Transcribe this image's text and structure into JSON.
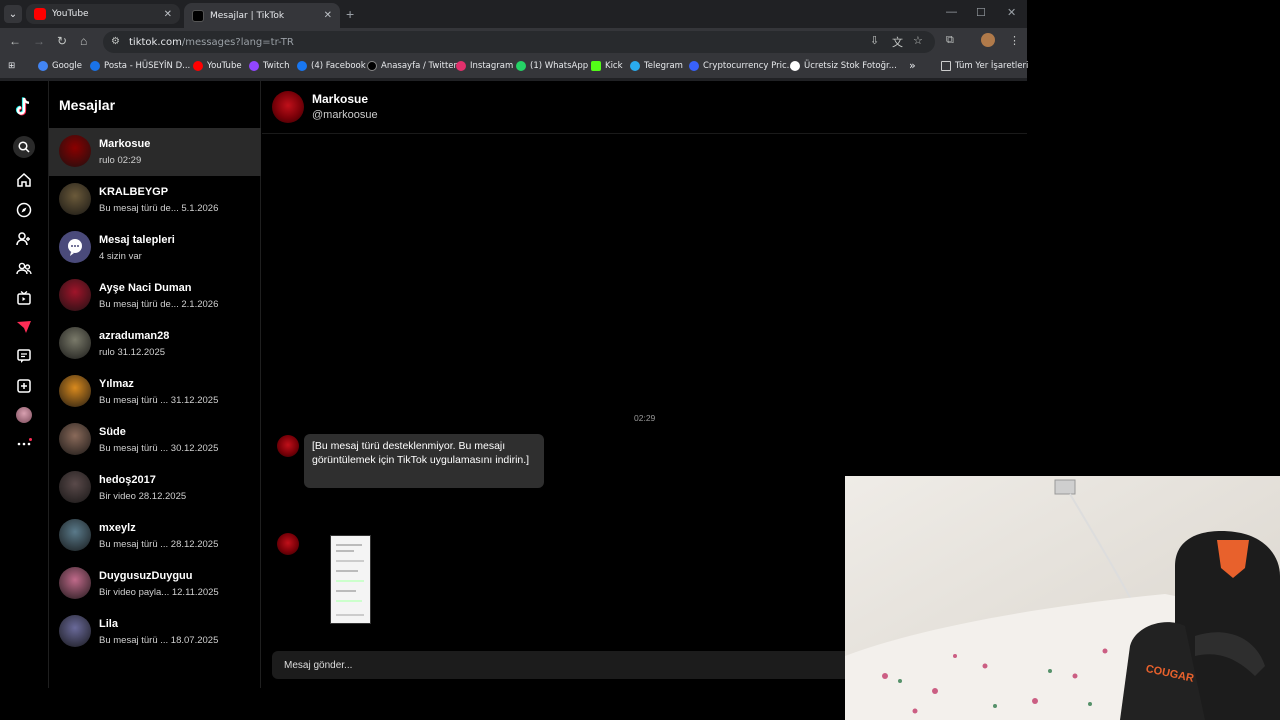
{
  "browser": {
    "tabs": [
      {
        "title": "YouTube",
        "favicon_color": "#ff0000"
      },
      {
        "title": "Mesajlar | TikTok",
        "favicon_color": "#000000"
      }
    ],
    "url_host": "tiktok.com",
    "url_path": "/messages?lang=tr-TR",
    "bookmarks": [
      {
        "label": "Google",
        "icon": "google-icon",
        "color": "#4285f4"
      },
      {
        "label": "Posta - HÜSEYİN D...",
        "icon": "mail-icon",
        "color": "#1a73e8"
      },
      {
        "label": "YouTube",
        "icon": "youtube-icon",
        "color": "#ff0000"
      },
      {
        "label": "Twitch",
        "icon": "twitch-icon",
        "color": "#9146ff"
      },
      {
        "label": "(4) Facebook",
        "icon": "facebook-icon",
        "color": "#1877f2"
      },
      {
        "label": "Anasayfa / Twitter",
        "icon": "x-icon",
        "color": "#000000"
      },
      {
        "label": "Instagram",
        "icon": "instagram-icon",
        "color": "#e1306c"
      },
      {
        "label": "(1) WhatsApp",
        "icon": "whatsapp-icon",
        "color": "#25d366"
      },
      {
        "label": "Kick",
        "icon": "kick-icon",
        "color": "#53fc18"
      },
      {
        "label": "Telegram",
        "icon": "telegram-icon",
        "color": "#2aabee"
      },
      {
        "label": "Cryptocurrency Pric...",
        "icon": "coin-icon",
        "color": "#3861fb"
      },
      {
        "label": "Ücretsiz Stok Fotoğr...",
        "icon": "photo-icon",
        "color": "#ffffff"
      }
    ],
    "bookmarks_overflow": "»",
    "all_bookmarks": "Tüm Yer İşaretleri"
  },
  "sidebar_title": "Mesajlar",
  "conversations": [
    {
      "name": "Markosue",
      "sub": "rulo 02:29",
      "selected": true,
      "avatar_color": "#8b0000"
    },
    {
      "name": "KRALBEYGP",
      "sub": "Bu mesaj türü de...  5.1.2026",
      "avatar_color": "#6b5a3a"
    },
    {
      "name": "Mesaj talepleri",
      "sub": "4 sizin var",
      "avatar_color": "#4a4a7a"
    },
    {
      "name": "Ayşe Naci Duman",
      "sub": "Bu mesaj türü de...  2.1.2026",
      "avatar_color": "#a0142a"
    },
    {
      "name": "azraduman28",
      "sub": "rulo 31.12.2025",
      "avatar_color": "#7a7a6a"
    },
    {
      "name": "Yılmaz",
      "sub": "Bu mesaj türü ...  31.12.2025",
      "avatar_color": "#d98a1e"
    },
    {
      "name": "Süde",
      "sub": "Bu mesaj türü ...  30.12.2025",
      "avatar_color": "#8a6a5a"
    },
    {
      "name": "hedoş2017",
      "sub": "Bir video 28.12.2025",
      "avatar_color": "#5a4a4a"
    },
    {
      "name": "mxeylz",
      "sub": "Bu mesaj türü ...  28.12.2025",
      "avatar_color": "#5a7a8a"
    },
    {
      "name": "DuygusuzDuyguu",
      "sub": "Bir video payla...  12.11.2025",
      "avatar_color": "#c06a8a"
    },
    {
      "name": "Lila",
      "sub": "Bu mesaj türü ...  18.07.2025",
      "avatar_color": "#6a6a9a"
    }
  ],
  "chat": {
    "name": "Markosue",
    "username": "@markoosue",
    "timestamp": "02:29",
    "message_text": "[Bu mesaj türü desteklenmiyor. Bu mesajı görüntülemek için TikTok uygulamasını indirin.]",
    "composer_placeholder": "Mesaj gönder..."
  },
  "webcam_chair_brand": "COUGAR"
}
